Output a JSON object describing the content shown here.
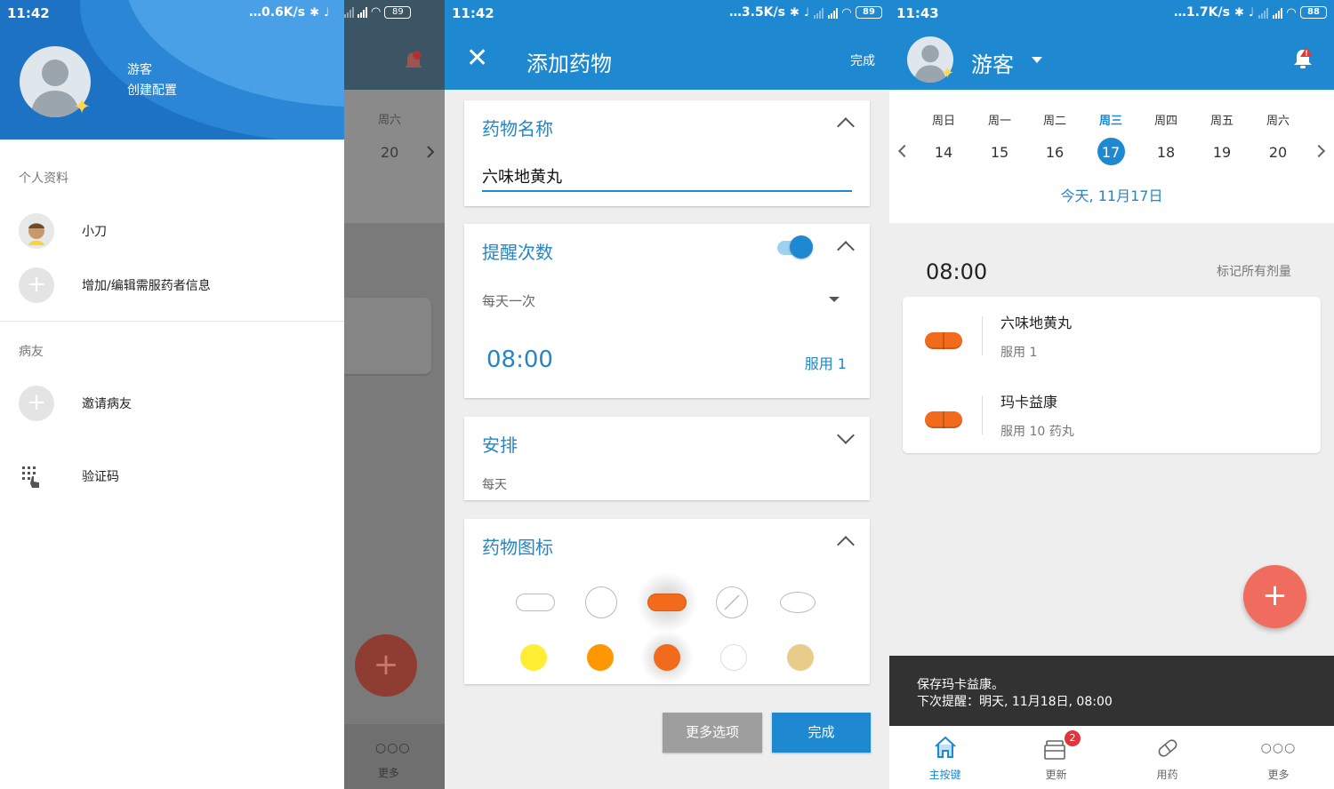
{
  "screen1": {
    "status": {
      "time": "11:42",
      "speed": "0.6K/s",
      "battery": "89"
    },
    "profile": {
      "name": "游客",
      "subtitle": "创建配置"
    },
    "sections": {
      "profiles_title": "个人资料",
      "friends_title": "病友"
    },
    "items": [
      {
        "label": "小刀"
      },
      {
        "label": "增加/编辑需服药者信息"
      },
      {
        "label": "邀请病友"
      },
      {
        "label": "验证码"
      }
    ],
    "behind": {
      "weekday": "周六",
      "day": "20",
      "more_label": "更多"
    }
  },
  "screen2": {
    "status": {
      "time": "11:42",
      "speed": "3.5K/s",
      "battery": "89"
    },
    "title": "添加药物",
    "done": "完成",
    "name_card": {
      "title": "药物名称",
      "value": "六味地黄丸"
    },
    "reminder_card": {
      "title": "提醒次数",
      "frequency": "每天一次",
      "time": "08:00",
      "dose": "服用 1",
      "toggle_on": true
    },
    "schedule_card": {
      "title": "安排",
      "value": "每天"
    },
    "icon_card": {
      "title": "药物图标",
      "shapes": [
        "capsule-white",
        "round-white",
        "capsule-orange",
        "scored-white",
        "oval-white"
      ],
      "selected_shape": 2,
      "colors": [
        "#ffee33",
        "#ff9800",
        "#f26b1d",
        "#ffffff",
        "#e8cc8a"
      ],
      "selected_color": 2
    },
    "buttons": {
      "more": "更多选项",
      "done": "完成"
    },
    "colors": {
      "primary": "#1e88d0",
      "more_btn": "#9e9e9e"
    }
  },
  "screen3": {
    "status": {
      "time": "11:43",
      "speed": "1.7K/s",
      "battery": "88"
    },
    "user": "游客",
    "weekdays": [
      "周日",
      "周一",
      "周二",
      "周三",
      "周四",
      "周五",
      "周六"
    ],
    "days": [
      "14",
      "15",
      "16",
      "17",
      "18",
      "19",
      "20"
    ],
    "selected_index": 3,
    "today": "今天, 11月17日",
    "slot_time": "08:00",
    "mark_all": "标记所有剂量",
    "meds": [
      {
        "name": "六味地黄丸",
        "dose": "服用 1"
      },
      {
        "name": "玛卡益康",
        "dose": "服用 10 药丸"
      }
    ],
    "snackbar": {
      "line1": "保存玛卡益康。",
      "line2": "下次提醒：明天, 11月18日, 08:00"
    },
    "nav": [
      {
        "label": "主按键",
        "icon": "home-icon",
        "active": true
      },
      {
        "label": "更新",
        "icon": "updates-icon",
        "badge": "2"
      },
      {
        "label": "用药",
        "icon": "pill-icon"
      },
      {
        "label": "更多",
        "icon": "more-icon"
      }
    ]
  }
}
